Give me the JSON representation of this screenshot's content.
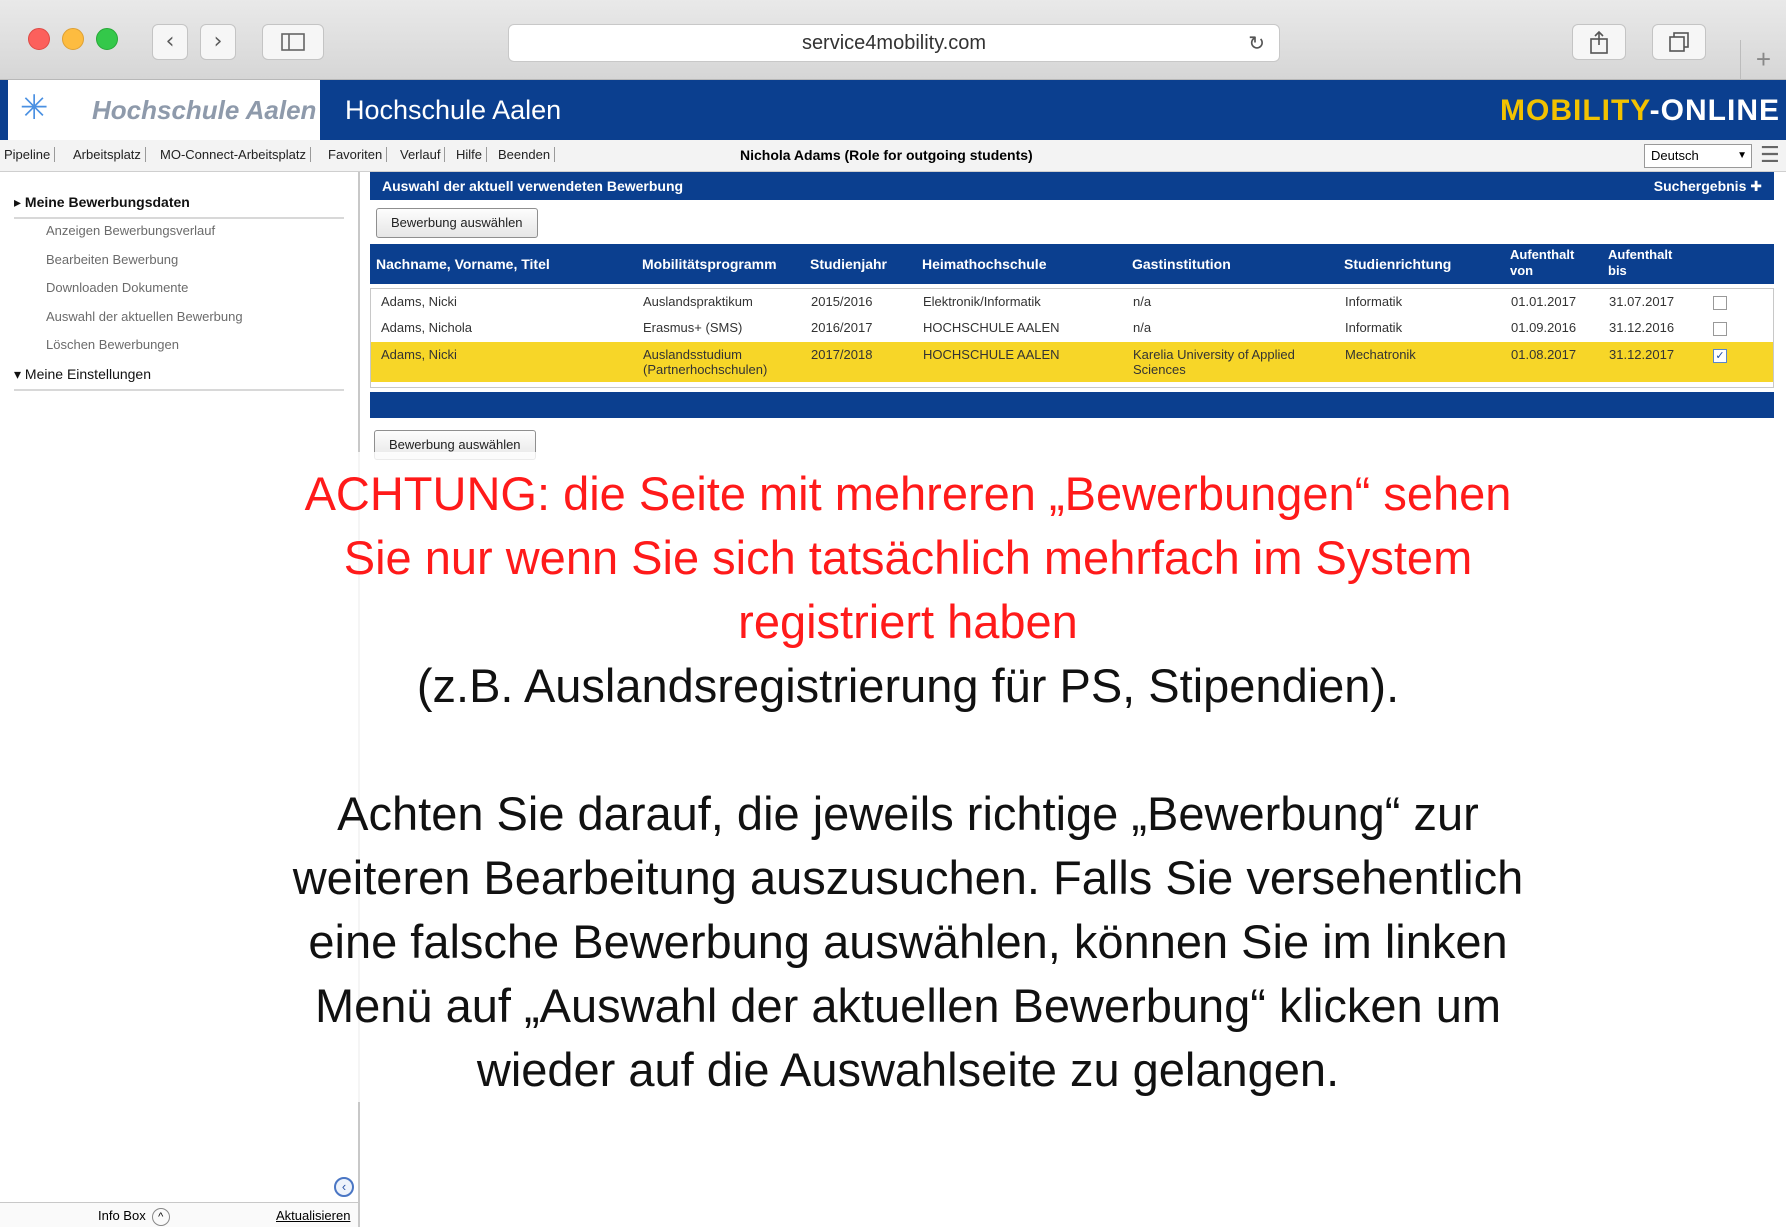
{
  "browser": {
    "url": "service4mobility.com"
  },
  "header": {
    "logo_text": "Hochschule Aalen",
    "institution": "Hochschule Aalen",
    "brand_part1": "MOBILITY",
    "brand_part2": "-ONLINE"
  },
  "menubar": {
    "items": [
      "Pipeline",
      "Arbeitsplatz",
      "MO-Connect-Arbeitsplatz",
      "Favoriten",
      "Verlauf",
      "Hilfe",
      "Beenden"
    ],
    "user": "Nichola Adams (Role for outgoing students)",
    "language": "Deutsch"
  },
  "sidebar": {
    "section1": "Meine Bewerbungsdaten",
    "items": [
      "Anzeigen Bewerbungsverlauf",
      "Bearbeiten Bewerbung",
      "Downloaden Dokumente",
      "Auswahl der aktuellen Bewerbung",
      "Löschen Bewerbungen"
    ],
    "section2": "Meine Einstellungen",
    "infobox": "Info Box",
    "refresh": "Aktualisieren"
  },
  "main": {
    "section_title": "Auswahl der aktuell verwendeten Bewerbung",
    "search_result": "Suchergebnis",
    "select_button": "Bewerbung auswählen",
    "columns": [
      "Nachname, Vorname, Titel",
      "Mobilitätsprogramm",
      "Studienjahr",
      "Heimathochschule",
      "Gastinstitution",
      "Studienrichtung",
      "Aufenthalt\nvon",
      "Aufenthalt\nbis"
    ],
    "rows": [
      {
        "name": "Adams, Nicki",
        "program": "Auslandspraktikum",
        "year": "2015/2016",
        "home": "Elektronik/Informatik",
        "host": "n/a",
        "field": "Informatik",
        "from": "01.01.2017",
        "to": "31.07.2017",
        "checked": false
      },
      {
        "name": "Adams, Nichola",
        "program": "Erasmus+ (SMS)",
        "year": "2016/2017",
        "home": "HOCHSCHULE AALEN",
        "host": "n/a",
        "field": "Informatik",
        "from": "01.09.2016",
        "to": "31.12.2016",
        "checked": false
      },
      {
        "name": "Adams, Nicki",
        "program": "Auslandsstudium\n(Partnerhochschulen)",
        "year": "2017/2018",
        "home": "HOCHSCHULE AALEN",
        "host": "Karelia University of Applied\nSciences",
        "field": "Mechatronik",
        "from": "01.08.2017",
        "to": "31.12.2017",
        "checked": true
      }
    ]
  },
  "annotation": {
    "warning_lines": [
      "ACHTUNG: die Seite mit mehreren „Bewerbungen“ sehen",
      "Sie nur wenn Sie sich tatsächlich mehrfach im System",
      "registriert haben"
    ],
    "example_line": "(z.B. Auslandsregistrierung für PS, Stipendien).",
    "note_lines": [
      "Achten Sie darauf, die jeweils richtige „Bewerbung“ zur",
      "weiteren Bearbeitung auszusuchen. Falls Sie versehentlich",
      "eine falsche Bewerbung auswählen, können Sie im linken",
      "Menü auf „Auswahl der aktuellen Bewerbung“ klicken um",
      "wieder auf die Auswahlseite zu gelangen."
    ]
  },
  "colors": {
    "primary_blue": "#0b3f8f",
    "selected_row": "#f7d628",
    "warning_red": "#ff1a1a"
  }
}
